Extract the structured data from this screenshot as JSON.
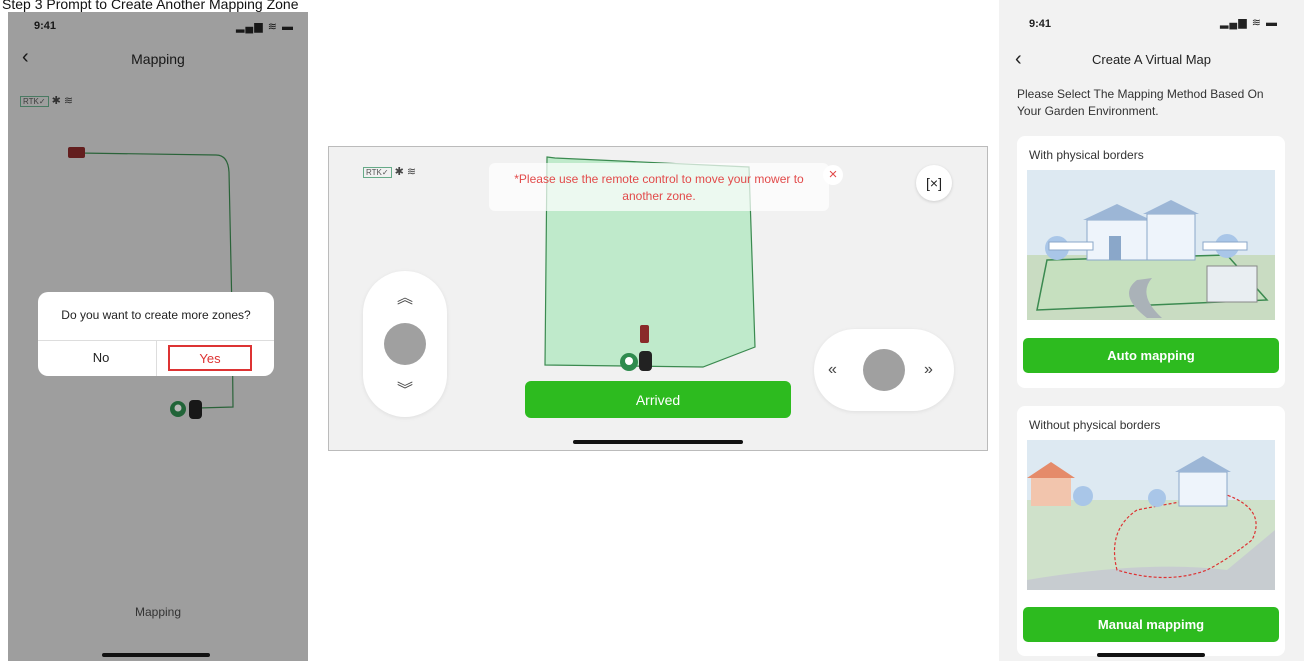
{
  "page": {
    "label": "Step 3 Prompt to Create Another Mapping Zone"
  },
  "phone1": {
    "status_time": "9:41",
    "title": "Mapping",
    "rtk_label": "RTK",
    "dialog": {
      "question": "Do you want to create more zones?",
      "no_label": "No",
      "yes_label": "Yes"
    },
    "bottom_label": "Mapping"
  },
  "landscape": {
    "rtk_label": "RTK",
    "toast_message": "*Please use the remote control to move your mower to another zone.",
    "toast_close_glyph": "×",
    "exit_glyph": "[×]",
    "arrived_label": "Arrived"
  },
  "phone3": {
    "status_time": "9:41",
    "title": "Create A Virtual Map",
    "instruction": "Please Select The Mapping Method Based On Your Garden Environment.",
    "cards": [
      {
        "title": "With physical borders",
        "button_label": "Auto mapping"
      },
      {
        "title": "Without physical borders",
        "button_label": "Manual mappimg"
      }
    ]
  },
  "colors": {
    "accent_green": "#2dbb1f",
    "alert_red": "#e24a4a",
    "zone_fill": "#bfeacb"
  }
}
